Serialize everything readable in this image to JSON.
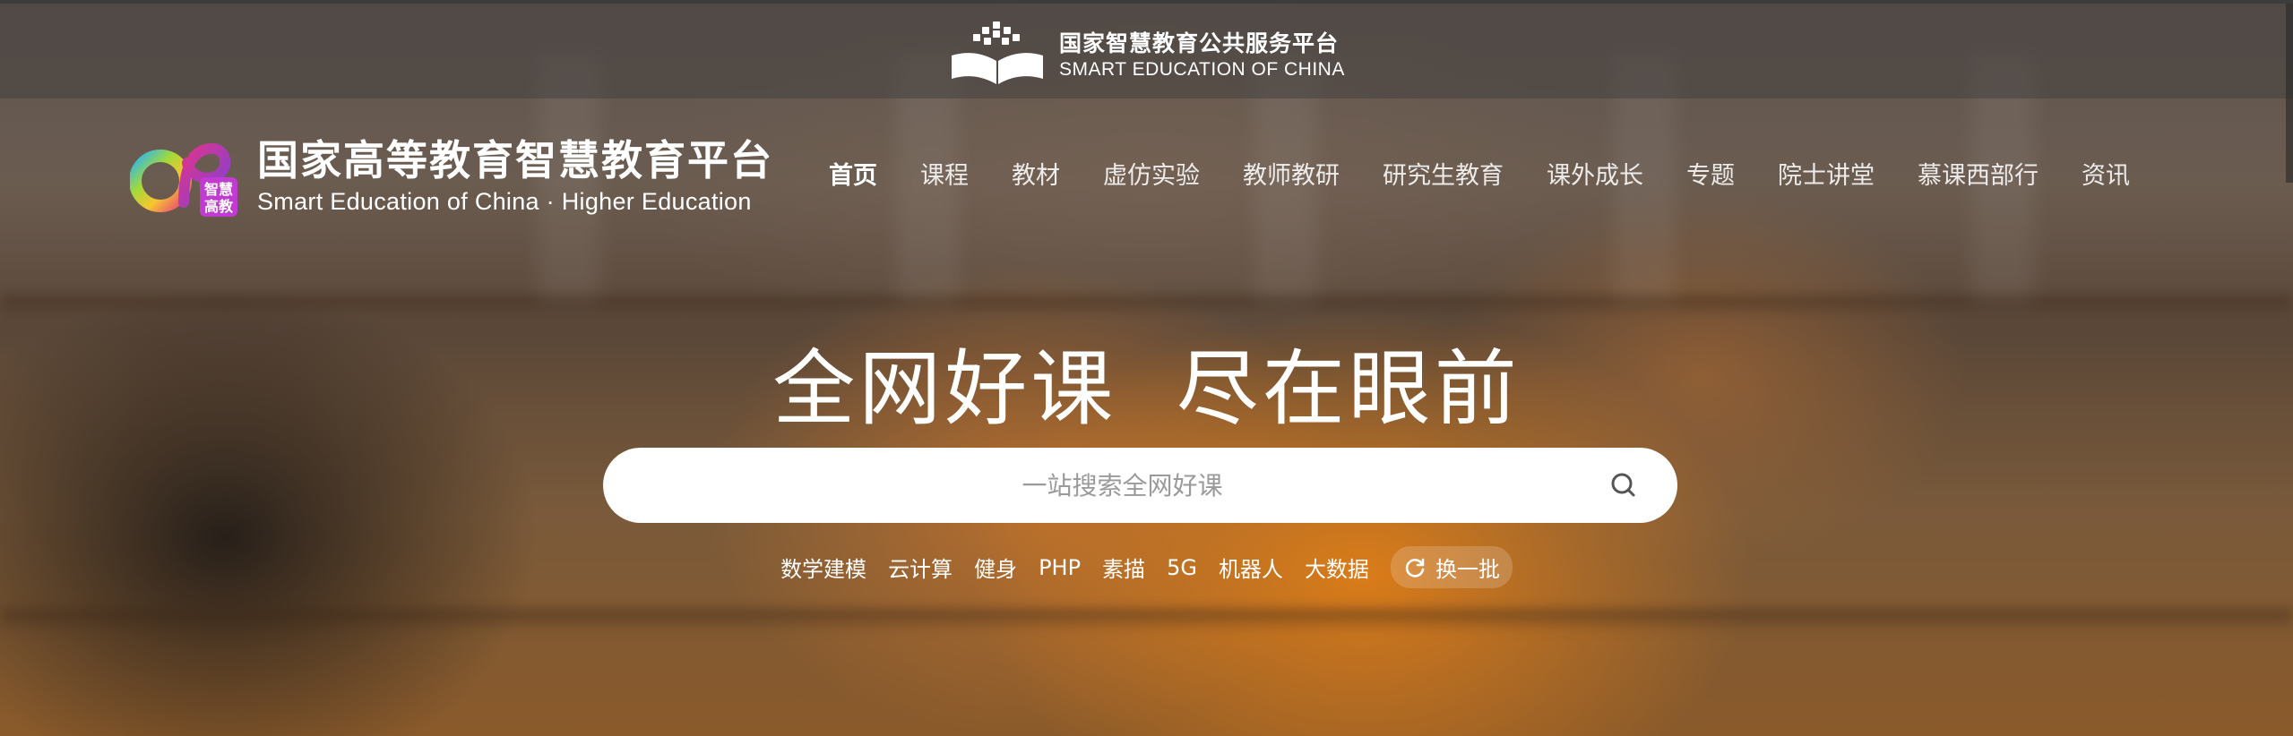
{
  "top_banner": {
    "title_cn": "国家智慧教育公共服务平台",
    "title_en": "SMART EDUCATION OF CHINA"
  },
  "brand": {
    "title_cn": "国家高等教育智慧教育平台",
    "title_en": "Smart Education of China · Higher Education",
    "badge_cn": "智慧高教"
  },
  "nav": {
    "items": [
      {
        "label": "首页",
        "active": true
      },
      {
        "label": "课程"
      },
      {
        "label": "教材"
      },
      {
        "label": "虚仿实验"
      },
      {
        "label": "教师教研"
      },
      {
        "label": "研究生教育"
      },
      {
        "label": "课外成长"
      },
      {
        "label": "专题"
      },
      {
        "label": "院士讲堂"
      },
      {
        "label": "慕课西部行"
      },
      {
        "label": "资讯"
      }
    ]
  },
  "hero": {
    "headline": "全网好课  尽在眼前"
  },
  "search": {
    "placeholder": "一站搜索全网好课",
    "icon": "search-icon"
  },
  "hot_tags": {
    "items": [
      "数学建模",
      "云计算",
      "健身",
      "PHP",
      "素描",
      "5G",
      "机器人",
      "大数据"
    ],
    "refresh_label": "换一批",
    "refresh_icon": "refresh-icon"
  },
  "colors": {
    "accent_orange": "#e8851a",
    "text": "#ffffff"
  }
}
